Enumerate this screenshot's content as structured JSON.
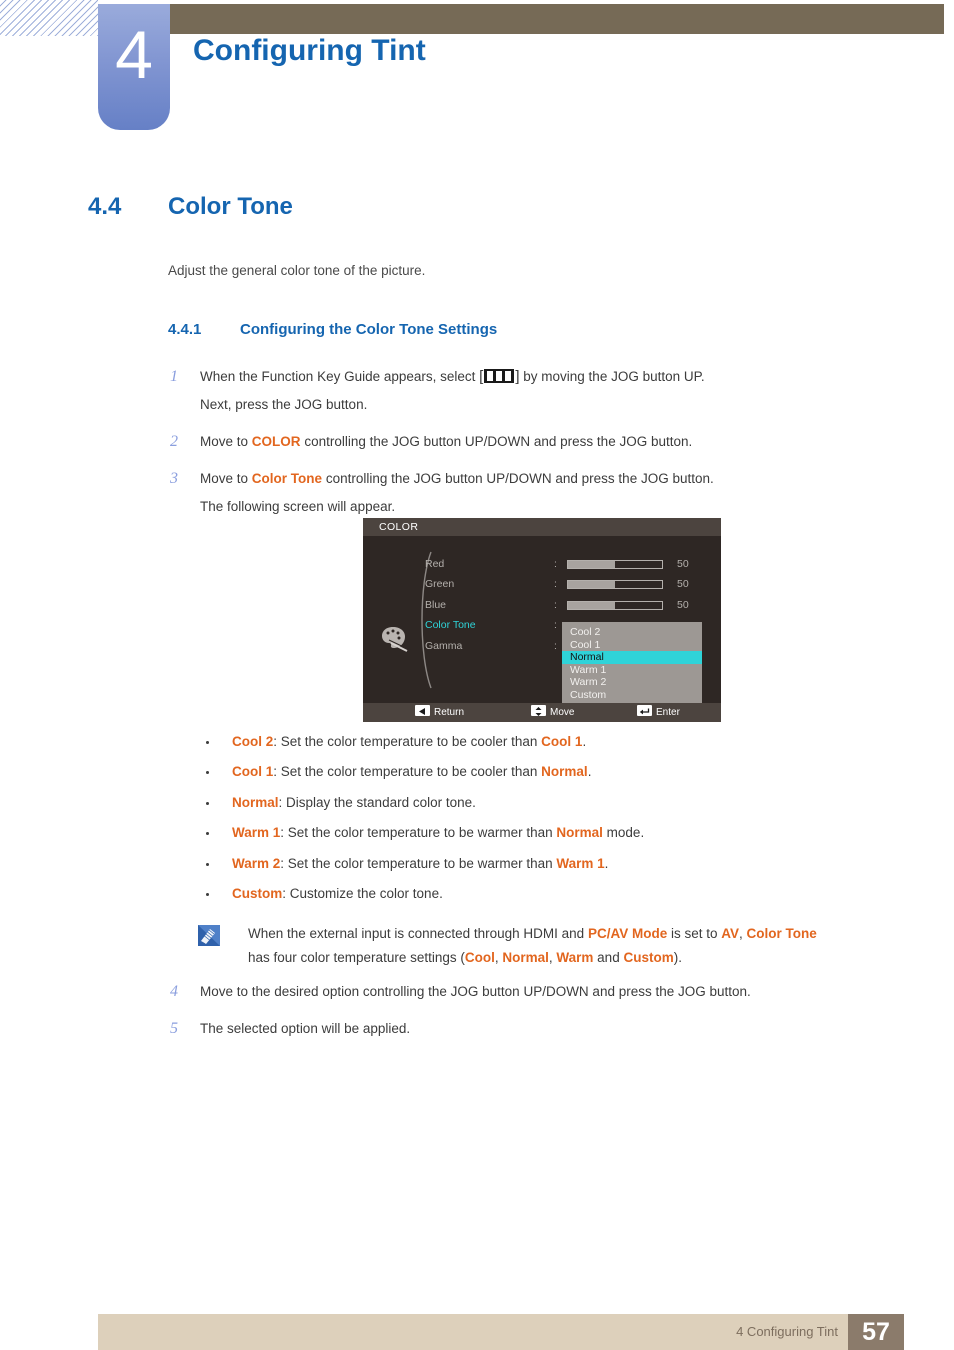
{
  "header": {
    "chapter_number": "4",
    "chapter_title": "Configuring Tint"
  },
  "section": {
    "number": "4.4",
    "title": "Color Tone",
    "lead": "Adjust the general color tone of the picture.",
    "subsection_number": "4.4.1",
    "subsection_title": "Configuring the Color Tone Settings"
  },
  "steps": {
    "step1_a": "When the Function Key Guide appears, select",
    "step1_b": "by moving the JOG button UP.",
    "step1_c": "Next, press the JOG button.",
    "step1_index": "1",
    "step2_index": "2",
    "step2_a": "Move to",
    "step2_kw": "COLOR",
    "step2_b": "controlling the JOG button UP/DOWN and press the JOG button.",
    "step3_index": "3",
    "step3_a": "Move to",
    "step3_kw": "Color Tone",
    "step3_b": "controlling the JOG button UP/DOWN and press the JOG button.",
    "step3_c": "The following screen will appear.",
    "step4_index": "4",
    "step4_text": "Move to the desired option controlling the JOG button UP/DOWN and press the JOG button.",
    "step5_index": "5",
    "step5_text": "The selected option will be applied.",
    "bracket_open": "[",
    "bracket_close": "]"
  },
  "osd": {
    "title": "COLOR",
    "rows": [
      {
        "label": "Red",
        "colon": ":",
        "value": "50",
        "fill_percent": 50
      },
      {
        "label": "Green",
        "colon": ":",
        "value": "50",
        "fill_percent": 50
      },
      {
        "label": "Blue",
        "colon": ":",
        "value": "50",
        "fill_percent": 50
      },
      {
        "label": "Color Tone",
        "colon": ":",
        "value": "",
        "fill_percent": 0
      },
      {
        "label": "Gamma",
        "colon": ":",
        "value": "",
        "fill_percent": 0
      }
    ],
    "dropdown": {
      "items": [
        "Cool 2",
        "Cool 1",
        "Normal",
        "Warm 1",
        "Warm 2",
        "Custom"
      ],
      "selected": "Normal"
    },
    "footer": {
      "return_label": "Return",
      "move_label": "Move",
      "enter_label": "Enter"
    },
    "colors": {
      "background": "#2e2724",
      "titlebar": "#4c443f",
      "highlight": "#2fd3d8",
      "dropdown_bg": "#9d9894",
      "text": "#b4b0ac"
    }
  },
  "bullets": [
    {
      "term": "Cool 2",
      "mid": ": Set the color temperature to be cooler than ",
      "term2": "Cool 1",
      "tail": "."
    },
    {
      "term": "Cool 1",
      "mid": ": Set the color temperature to be cooler than ",
      "term2": "Normal",
      "tail": "."
    },
    {
      "term": "Normal",
      "mid": ": Display the standard color tone.",
      "term2": "",
      "tail": ""
    },
    {
      "term": "Warm 1",
      "mid": ": Set the color temperature to be warmer than ",
      "term2": "Normal",
      "tail": " mode."
    },
    {
      "term": "Warm 2",
      "mid": ": Set the color temperature to be warmer than ",
      "term2": "Warm 1",
      "tail": "."
    },
    {
      "term": "Custom",
      "mid": ": Customize the color tone.",
      "term2": "",
      "tail": ""
    }
  ],
  "note": {
    "p1": "When the external input is connected through HDMI and ",
    "kw1": "PC/AV Mode",
    "p2": " is set to ",
    "kw2": "AV",
    "p3": ", ",
    "kw3": "Color Tone",
    "p4": "has four color temperature settings (",
    "kw4": "Cool",
    "p5": ", ",
    "kw5": "Normal",
    "p6": ", ",
    "kw6": "Warm",
    "p7": " and ",
    "kw7": "Custom",
    "p8": ")."
  },
  "footer": {
    "label": "4 Configuring Tint",
    "page": "57"
  },
  "theme": {
    "heading_blue": "#1565b0",
    "keyword_orange": "#e2661f",
    "header_brown": "#766a56",
    "footer_beige": "#ddd0bb",
    "page_box": "#8b7b6b"
  }
}
